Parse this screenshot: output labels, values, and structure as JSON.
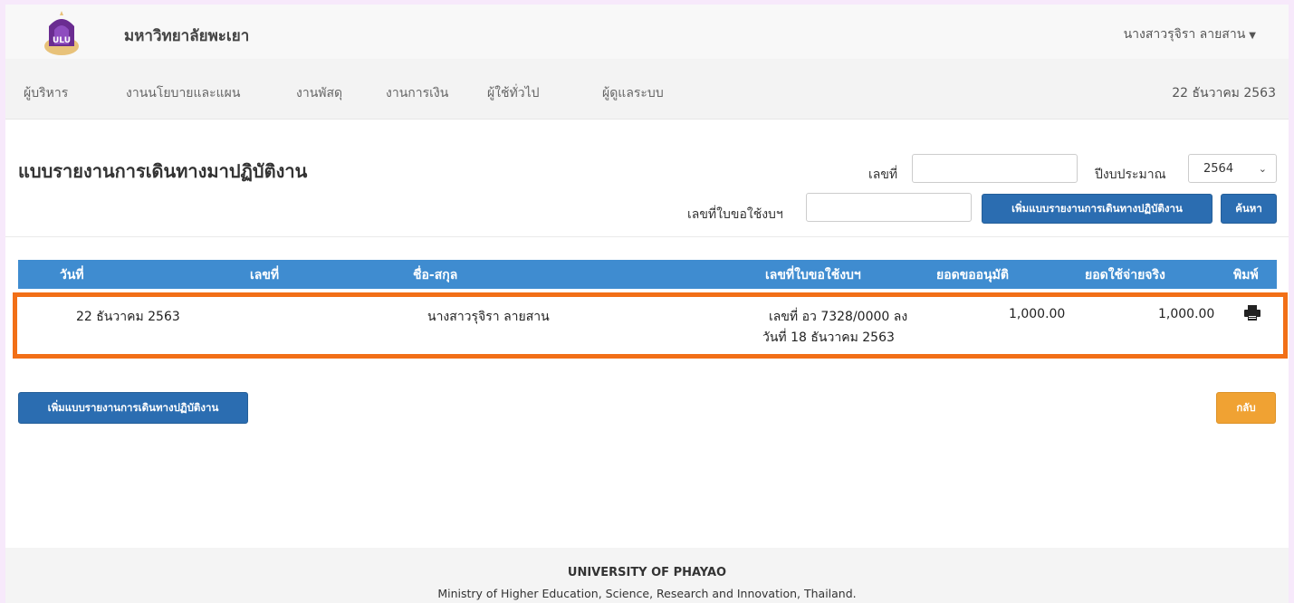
{
  "header": {
    "brand": "มหาวิทยาลัยพะเยา",
    "user": "นางสาวรุจิรา ลายสาน"
  },
  "nav": {
    "items": [
      "ผู้บริหาร",
      "งานนโยบายและแผน",
      "งานพัสดุ",
      "งานการเงิน",
      "ผู้ใช้ทั่วไป",
      "ผู้ดูแลระบบ"
    ],
    "date": "22 ธันวาคม 2563"
  },
  "form": {
    "title": "แบบรายงานการเดินทางมาปฏิบัติงาน",
    "doc_no_label": "เลขที่",
    "doc_no_value": "",
    "year_label": "ปีงบประมาณ",
    "year_value": "2564",
    "request_no_label": "เลขที่ใบขอใช้งบฯ",
    "request_no_value": "",
    "add_button": "เพิ่มแบบรายงานการเดินทางปฏิบัติงาน",
    "search_button": "ค้นหา"
  },
  "table": {
    "columns": [
      "วันที่",
      "เลขที่",
      "ชื่อ-สกุล",
      "เลขที่ใบขอใช้งบฯ",
      "ยอดขออนุมัติ",
      "ยอดใช้จ่ายจริง",
      "พิมพ์"
    ],
    "rows": [
      {
        "date": "22 ธันวาคม 2563",
        "number": "",
        "name": "นางสาวรุจิรา ลายสาน",
        "request_line1": "เลขที่ อว 7328/0000 ลง",
        "request_line2": "วันที่ 18 ธันวาคม 2563",
        "approved": "1,000.00",
        "actual": "1,000.00",
        "print_icon": "printer-icon"
      }
    ]
  },
  "bottom": {
    "add_button": "เพิ่มแบบรายงานการเดินทางปฏิบัติงาน",
    "back_button": "กลับ"
  },
  "footer": {
    "line1": "UNIVERSITY OF PHAYAO",
    "line2": "Ministry of Higher Education, Science, Research and Innovation, Thailand."
  },
  "colors": {
    "table_header": "#3f8cd0",
    "primary_button": "#2b6db1",
    "warning_button": "#f0a233",
    "highlight": "#f26f17"
  }
}
